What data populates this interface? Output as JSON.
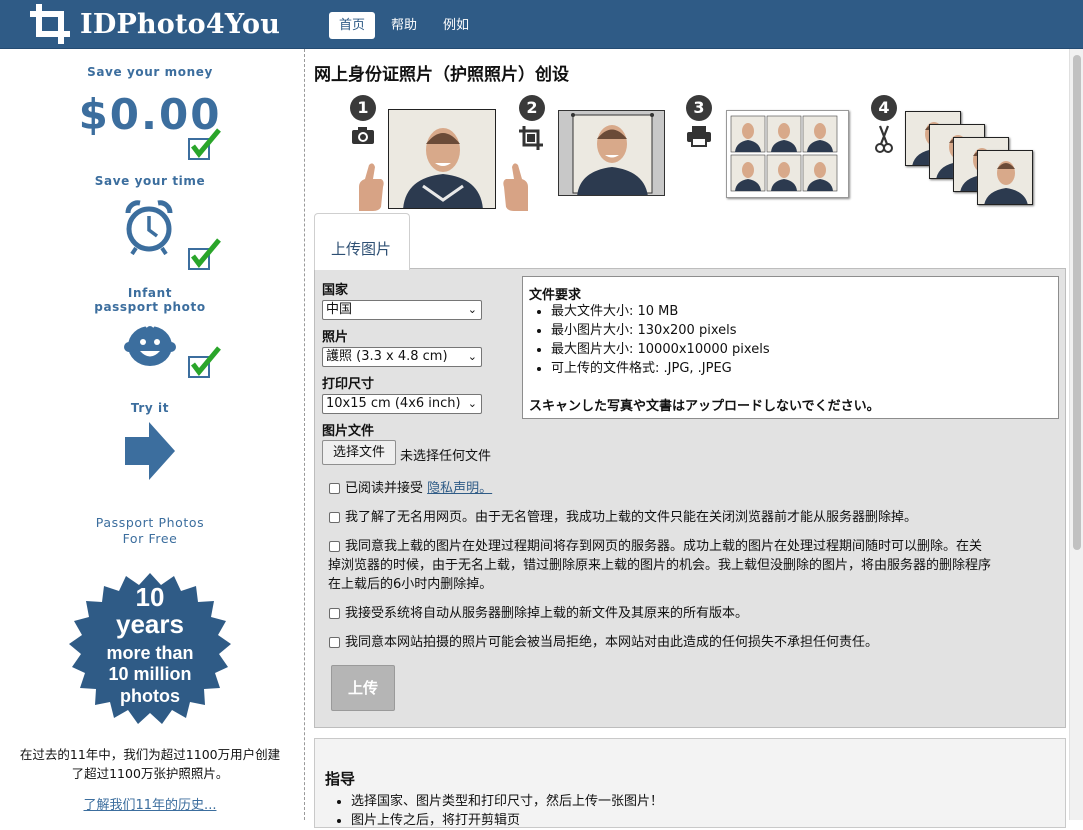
{
  "header": {
    "logo_text": "IDPhoto4You",
    "nav": [
      {
        "label": "首页"
      },
      {
        "label": "帮助"
      },
      {
        "label": "例如"
      }
    ]
  },
  "sidebar": {
    "save_money": "Save your money",
    "price": "$0.00",
    "save_time": "Save your time",
    "infant_line1": "Infant",
    "infant_line2": "passport photo",
    "try_it": "Try it",
    "free_line1": "Passport Photos",
    "free_line2": "For Free",
    "badge_line1": "10",
    "badge_line2": "years",
    "badge_line3": "more than",
    "badge_line4": "10 million",
    "badge_line5": "photos",
    "history_line1": "在过去的11年中，我们为超过1100万用户创建",
    "history_line2": "了超过1100万张护照照片。",
    "history_link": "了解我们11年的历史..."
  },
  "main": {
    "title": "网上身份证照片（护照照片）创设",
    "steps": [
      "1",
      "2",
      "3",
      "4"
    ],
    "tab_label": "上传图片",
    "country_label": "国家",
    "country_value": "中国",
    "photo_label": "照片",
    "photo_value": "護照 (3.3 x 4.8 cm)",
    "print_label": "打印尺寸",
    "print_value": "10x15 cm (4x6 inch)",
    "file_label": "图片文件",
    "file_button": "选择文件",
    "file_status": "未选择任何文件",
    "requirements": {
      "title": "文件要求",
      "items": [
        "最大文件大小: 10 MB",
        "最小图片大小: 130x200 pixels",
        "最大图片大小: 10000x10000 pixels",
        "可上传的文件格式: .JPG, .JPEG"
      ],
      "warning": "スキャンした写真や文書はアップロードしないでください。"
    },
    "checkboxes": {
      "privacy_text": "已阅读并接受",
      "privacy_link": "隐私声明。",
      "c2": "我了解了无名用网页。由于无名管理，我成功上载的文件只能在关闭浏览器前才能从服务器删除掉。",
      "c3_line1": "我同意我上载的图片在处理过程期间将存到网页的服务器。成功上载的图片在处理过程期间随时可以删除。在关",
      "c3_line2": "掉浏览器的时候，由于无名上载，错过删除原来上载的图片的机会。我上载但没删除的图片，将由服务器的删除程序",
      "c3_line3": "在上载后的6小时内删除掉。",
      "c4": "我接受系统将自动从服务器删除掉上载的新文件及其原来的所有版本。",
      "c5": "我同意本网站拍摄的照片可能会被当局拒绝，本网站对由此造成的任何损失不承担任何责任。"
    },
    "upload_button": "上传",
    "guide": {
      "title": "指导",
      "items": [
        "选择国家、图片类型和打印尺寸，然后上传一张图片！",
        "图片上传之后，将打开剪辑页"
      ]
    }
  },
  "colors": {
    "header_bg": "#2f5b86",
    "brand_blue": "#3c6e9e",
    "check_green": "#2aa52a",
    "panel_bg": "#e2e2e2"
  },
  "icons": [
    "crop-logo-icon",
    "alarm-clock-icon",
    "baby-face-icon",
    "arrow-right-icon",
    "camera-icon",
    "crop-icon",
    "printer-icon",
    "scissors-icon",
    "checkmark-icon"
  ]
}
